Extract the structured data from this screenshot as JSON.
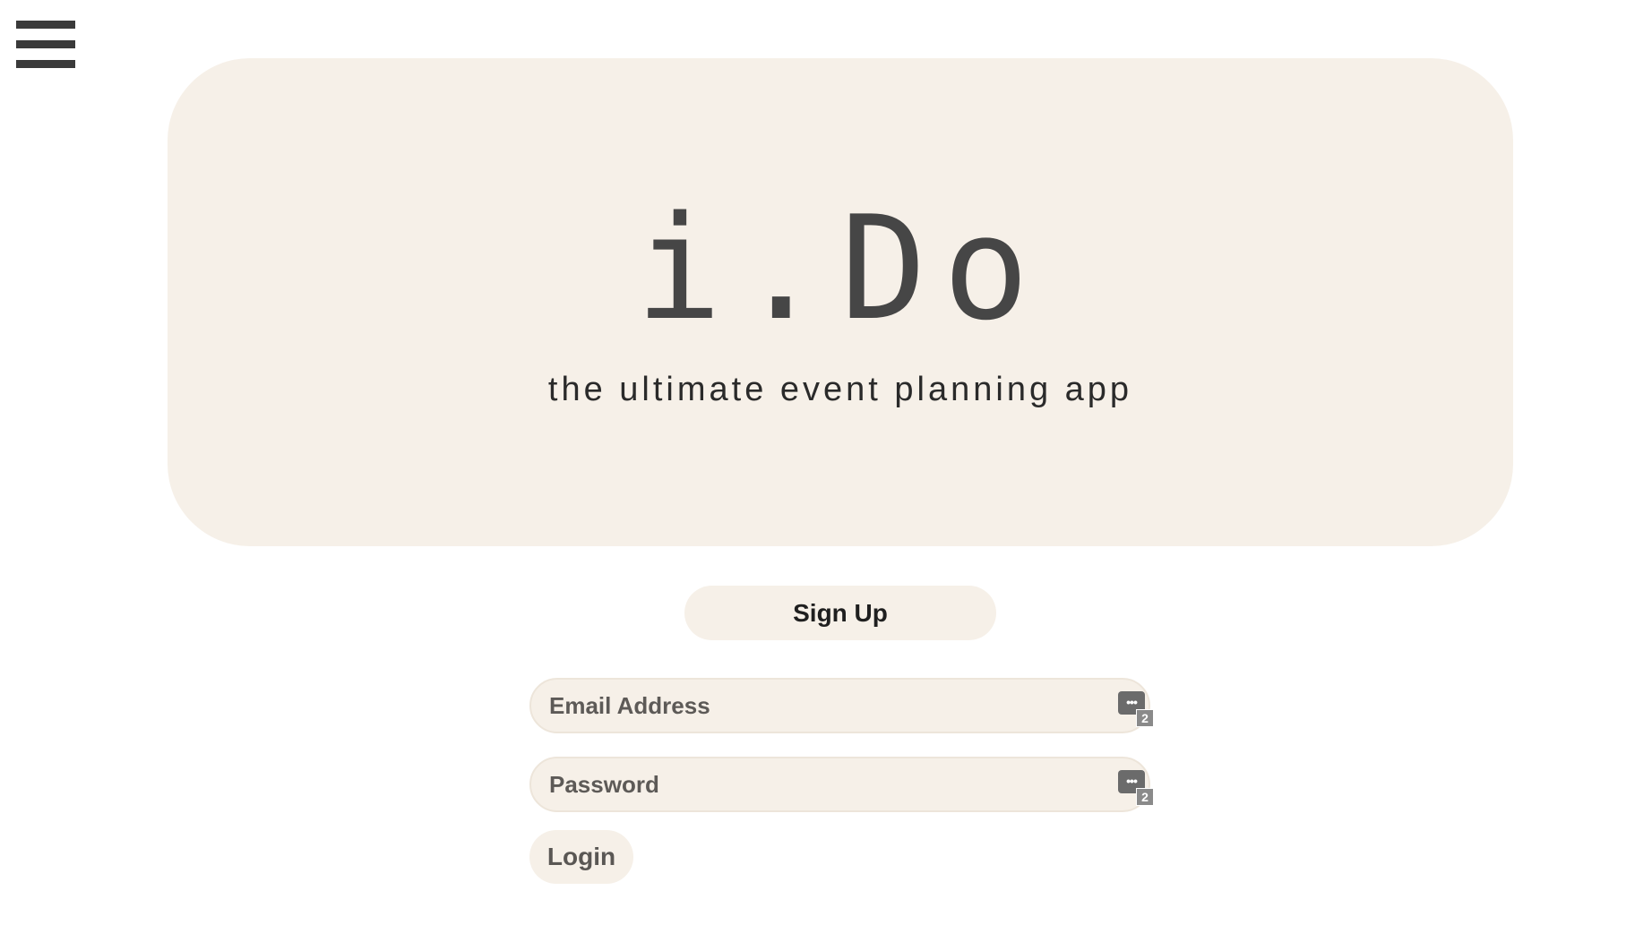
{
  "app": {
    "logo_text": "i.Do",
    "tagline": "the ultimate event planning app"
  },
  "menu": {
    "icon": "hamburger-menu-icon"
  },
  "signup": {
    "label": "Sign Up"
  },
  "login_form": {
    "email": {
      "placeholder": "Email Address",
      "value": ""
    },
    "password": {
      "placeholder": "Password",
      "value": ""
    },
    "password_manager": {
      "icon": "password-manager-icon",
      "bubble_glyph": "•••",
      "count": "2"
    },
    "login_label": "Login"
  },
  "colors": {
    "card_background": "#f6f0e8",
    "text_dark": "#2f2f2f",
    "icon_dark": "#3a3a3a"
  }
}
